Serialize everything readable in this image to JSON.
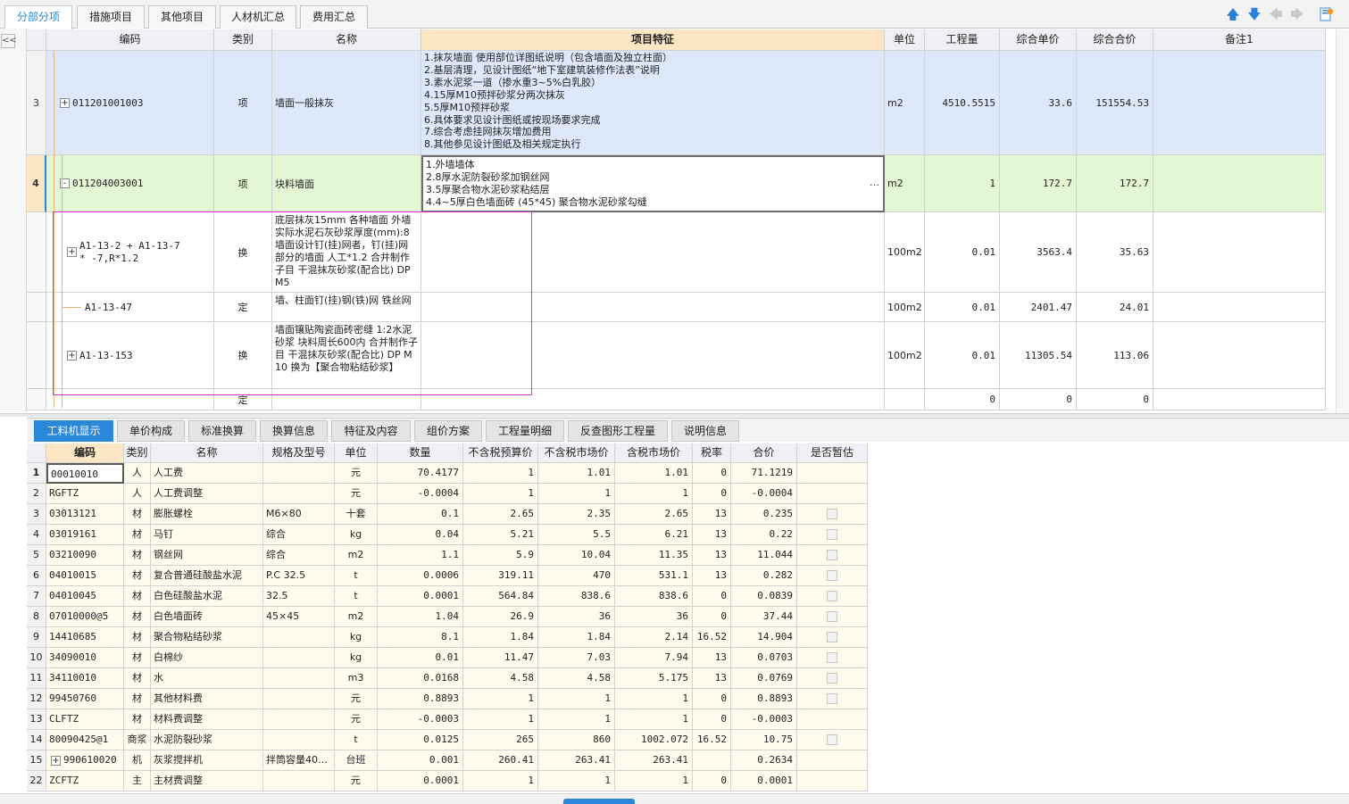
{
  "top_tabs": [
    "分部分项",
    "措施项目",
    "其他项目",
    "人材机汇总",
    "费用汇总"
  ],
  "toolbar_icons": [
    "arrow-up-icon",
    "arrow-down-icon",
    "arrow-left-icon",
    "arrow-right-icon",
    "settings-icon"
  ],
  "collapse_label": "<<",
  "upper_headers": [
    "编码",
    "类别",
    "名称",
    "项目特征",
    "单位",
    "工程量",
    "综合单价",
    "综合合价",
    "备注1"
  ],
  "upper_rows": [
    {
      "num": "3",
      "code": "011201001003",
      "type": "项",
      "name": "墙面一般抹灰",
      "feature": "1.抹灰墙面 使用部位详图纸说明（包含墙面及独立柱面）\n2.基层清理，见设计图纸“地下室建筑装修作法表”说明\n3.素水泥浆一道（掺水重3~5%白乳胶）\n4.15厚M10预拌砂浆分两次抹灰\n5.5厚M10预拌砂浆\n6.具体要求见设计图纸或按现场要求完成\n7.综合考虑挂网抹灰增加费用\n8.其他参见设计图纸及相关规定执行",
      "unit": "m2",
      "qty": "4510.5515",
      "price": "33.6",
      "total": "151554.53",
      "tree": "+"
    },
    {
      "num": "4",
      "code": "011204003001",
      "type": "项",
      "name": "块料墙面",
      "feature": "1.外墙墙体\n2.8厚水泥防裂砂浆加钢丝网\n3.5厚聚合物水泥砂浆粘结层\n4.4~5厚白色墙面砖 (45*45) 聚合物水泥砂浆勾缝",
      "unit": "m2",
      "qty": "1",
      "price": "172.7",
      "total": "172.7",
      "tree": "-",
      "ellipsis": "…"
    },
    {
      "num": "",
      "code": "A1-13-2 + A1-13-7 * -7,R*1.2",
      "type": "换",
      "name": "底层抹灰15mm 各种墙面 外墙 实际水泥石灰砂浆厚度(mm):8 墙面设计钉(挂)网者，钉(挂)网部分的墙面 人工*1.2 合并制作子目 干混抹灰砂浆(配合比) DP M5",
      "feature": "",
      "unit": "100m2",
      "qty": "0.01",
      "price": "3563.4",
      "total": "35.63",
      "tree": "+"
    },
    {
      "num": "",
      "code": "A1-13-47",
      "type": "定",
      "name": "墙、柱面钉(挂)钢(铁)网 铁丝网",
      "feature": "",
      "unit": "100m2",
      "qty": "0.01",
      "price": "2401.47",
      "total": "24.01",
      "tree": ""
    },
    {
      "num": "",
      "code": "A1-13-153",
      "type": "换",
      "name": "墙面镶贴陶瓷面砖密缝 1:2水泥砂浆 块料周长600内 合并制作子目 干混抹灰砂浆(配合比) DP M10 换为【聚合物粘结砂浆】",
      "feature": "",
      "unit": "100m2",
      "qty": "0.01",
      "price": "11305.54",
      "total": "113.06",
      "tree": "+"
    },
    {
      "num": "",
      "code": "",
      "type": "定",
      "name": "",
      "feature": "",
      "unit": "",
      "qty": "0",
      "price": "0",
      "total": "0",
      "tree": ""
    }
  ],
  "bottom_tabs": [
    "工料机显示",
    "单价构成",
    "标准换算",
    "换算信息",
    "特征及内容",
    "组价方案",
    "工程量明细",
    "反查图形工程量",
    "说明信息"
  ],
  "lower_headers": [
    "编码",
    "类别",
    "名称",
    "规格及型号",
    "单位",
    "数量",
    "不含税预算价",
    "不含税市场价",
    "含税市场价",
    "税率",
    "合价",
    "是否暂估"
  ],
  "lower_rows": [
    {
      "num": "1",
      "code": "00010010",
      "type": "人",
      "name": "人工费",
      "spec": "",
      "unit": "元",
      "qty": "70.4177",
      "budget": "1",
      "market": "1.01",
      "taxed": "1.01",
      "rate": "0",
      "total": "71.1219",
      "est": false
    },
    {
      "num": "2",
      "code": "RGFTZ",
      "type": "人",
      "name": "人工费调整",
      "spec": "",
      "unit": "元",
      "qty": "-0.0004",
      "budget": "1",
      "market": "1",
      "taxed": "1",
      "rate": "0",
      "total": "-0.0004",
      "est": false
    },
    {
      "num": "3",
      "code": "03013121",
      "type": "材",
      "name": "膨胀螺栓",
      "spec": "M6×80",
      "unit": "十套",
      "qty": "0.1",
      "budget": "2.65",
      "market": "2.35",
      "taxed": "2.65",
      "rate": "13",
      "total": "0.235",
      "est": true
    },
    {
      "num": "4",
      "code": "03019161",
      "type": "材",
      "name": "马钉",
      "spec": "综合",
      "unit": "kg",
      "qty": "0.04",
      "budget": "5.21",
      "market": "5.5",
      "taxed": "6.21",
      "rate": "13",
      "total": "0.22",
      "est": true
    },
    {
      "num": "5",
      "code": "03210090",
      "type": "材",
      "name": "钢丝网",
      "spec": "综合",
      "unit": "m2",
      "qty": "1.1",
      "budget": "5.9",
      "market": "10.04",
      "taxed": "11.35",
      "rate": "13",
      "total": "11.044",
      "est": true
    },
    {
      "num": "6",
      "code": "04010015",
      "type": "材",
      "name": "复合普通硅酸盐水泥",
      "spec": "P.C 32.5",
      "unit": "t",
      "qty": "0.0006",
      "budget": "319.11",
      "market": "470",
      "taxed": "531.1",
      "rate": "13",
      "total": "0.282",
      "est": true
    },
    {
      "num": "7",
      "code": "04010045",
      "type": "材",
      "name": "白色硅酸盐水泥",
      "spec": "32.5",
      "unit": "t",
      "qty": "0.0001",
      "budget": "564.84",
      "market": "838.6",
      "taxed": "838.6",
      "rate": "0",
      "total": "0.0839",
      "est": true
    },
    {
      "num": "8",
      "code": "07010000@5",
      "type": "材",
      "name": "白色墙面砖",
      "spec": "45×45",
      "unit": "m2",
      "qty": "1.04",
      "budget": "26.9",
      "market": "36",
      "taxed": "36",
      "rate": "0",
      "total": "37.44",
      "est": true
    },
    {
      "num": "9",
      "code": "14410685",
      "type": "材",
      "name": "聚合物粘结砂浆",
      "spec": "",
      "unit": "kg",
      "qty": "8.1",
      "budget": "1.84",
      "market": "1.84",
      "taxed": "2.14",
      "rate": "16.52",
      "total": "14.904",
      "est": true
    },
    {
      "num": "10",
      "code": "34090010",
      "type": "材",
      "name": "白棉纱",
      "spec": "",
      "unit": "kg",
      "qty": "0.01",
      "budget": "11.47",
      "market": "7.03",
      "taxed": "7.94",
      "rate": "13",
      "total": "0.0703",
      "est": true
    },
    {
      "num": "11",
      "code": "34110010",
      "type": "材",
      "name": "水",
      "spec": "",
      "unit": "m3",
      "qty": "0.0168",
      "budget": "4.58",
      "market": "4.58",
      "taxed": "5.175",
      "rate": "13",
      "total": "0.0769",
      "est": true
    },
    {
      "num": "12",
      "code": "99450760",
      "type": "材",
      "name": "其他材料费",
      "spec": "",
      "unit": "元",
      "qty": "0.8893",
      "budget": "1",
      "market": "1",
      "taxed": "1",
      "rate": "0",
      "total": "0.8893",
      "est": true
    },
    {
      "num": "13",
      "code": "CLFTZ",
      "type": "材",
      "name": "材料费调整",
      "spec": "",
      "unit": "元",
      "qty": "-0.0003",
      "budget": "1",
      "market": "1",
      "taxed": "1",
      "rate": "0",
      "total": "-0.0003",
      "est": false
    },
    {
      "num": "14",
      "code": "80090425@1",
      "type": "商浆",
      "name": "水泥防裂砂浆",
      "spec": "",
      "unit": "t",
      "qty": "0.0125",
      "budget": "265",
      "market": "860",
      "taxed": "1002.072",
      "rate": "16.52",
      "total": "10.75",
      "est": true
    },
    {
      "num": "15",
      "code": "990610020",
      "type": "机",
      "name": "灰浆搅拌机",
      "spec": "拌筒容量40…",
      "unit": "台班",
      "qty": "0.001",
      "budget": "260.41",
      "market": "263.41",
      "taxed": "263.41",
      "rate": "",
      "total": "0.2634",
      "est": false,
      "tree": "+"
    },
    {
      "num": "22",
      "code": "ZCFTZ",
      "type": "主",
      "name": "主材费调整",
      "spec": "",
      "unit": "元",
      "qty": "0.0001",
      "budget": "1",
      "market": "1",
      "taxed": "1",
      "rate": "0",
      "total": "0.0001",
      "est": false
    }
  ],
  "colors": {
    "accent": "#2b87d9",
    "row_blue": "#dde8fb",
    "row_green": "#e3f7d4",
    "feature_header": "#fce6c4",
    "lower_bg": "#fffcee",
    "magenta": "#d33ad2"
  }
}
